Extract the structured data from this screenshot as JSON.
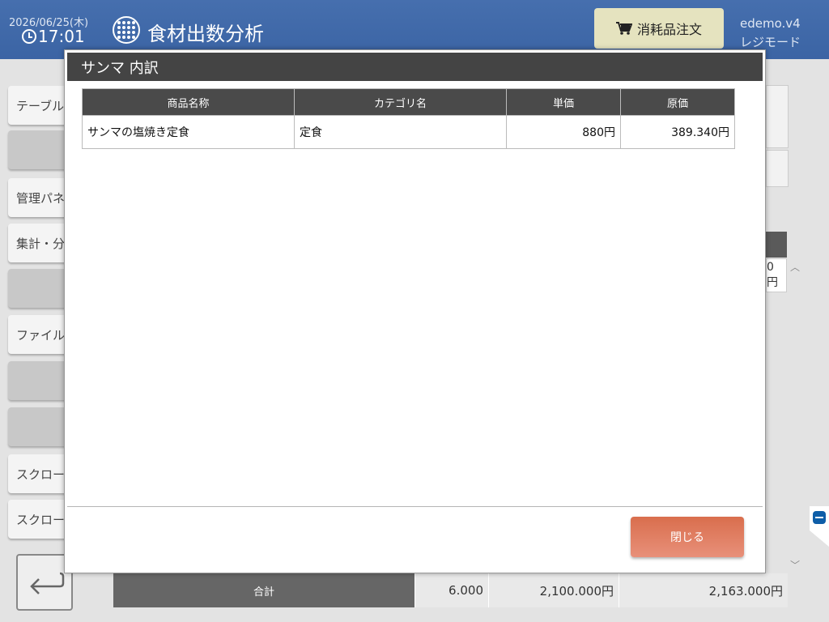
{
  "header": {
    "date": "2026/06/25(木)",
    "time": "17:01",
    "app_title": "食材出数分析",
    "order_button": "消耗品注文",
    "user_name": "edemo.v4",
    "mode": "レジモード"
  },
  "sidebar": {
    "items": [
      {
        "label": "テーブル"
      },
      {
        "label": ""
      },
      {
        "label": "管理パネ"
      },
      {
        "label": "集計・分"
      },
      {
        "label": ""
      },
      {
        "label": "ファイル"
      },
      {
        "label": ""
      },
      {
        "label": ""
      },
      {
        "label": "スクロー"
      },
      {
        "label": "スクロー"
      }
    ]
  },
  "background_table": {
    "partial_cell": "0円",
    "totals": {
      "label": "合計",
      "quantity": "6.000",
      "amount1": "2,100.000円",
      "amount2": "2,163.000円"
    }
  },
  "modal": {
    "title": "サンマ 内訳",
    "columns": [
      "商品名称",
      "カテゴリ名",
      "単価",
      "原価"
    ],
    "rows": [
      {
        "name": "サンマの塩焼き定食",
        "category": "定食",
        "unit_price": "880円",
        "cost": "389.340円"
      }
    ],
    "close_button": "閉じる"
  },
  "colors": {
    "header_bg": "#3f68a8",
    "order_button_bg": "#e5e3bf",
    "modal_header_bg": "#444444",
    "close_button_bg": "#e07f63"
  }
}
